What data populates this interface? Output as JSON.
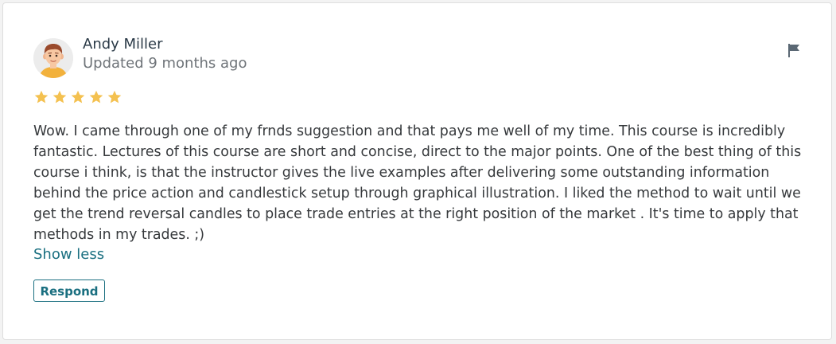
{
  "review": {
    "author": "Andy Miller",
    "updated": "Updated 9 months ago",
    "rating": 5,
    "max_rating": 5,
    "body_lines": [
      "Wow. I came through one of my frnds suggestion and that pays me well of my time. This course is incredibly",
      "fantastic. Lectures of this course are short and concise, direct to the major points. One of the best thing of this",
      "course i think, is that the instructor gives the live examples after delivering some outstanding information",
      "behind the price action and candlestick setup through graphical illustration. I liked the method to wait until we",
      "get the trend reversal candles to place trade entries at the right position of the market . It's time to apply that",
      "methods in my trades. ;)"
    ],
    "show_less_label": "Show less",
    "respond_label": "Respond"
  },
  "colors": {
    "star": "#f4c150",
    "link": "#1a6f80",
    "text": "#36393c"
  },
  "icons": {
    "avatar": "user-avatar-icon",
    "report": "flag-icon",
    "rating": "star-icon"
  }
}
